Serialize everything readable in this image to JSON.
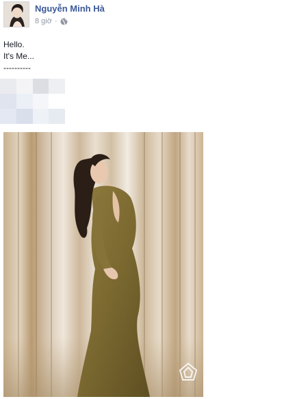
{
  "post": {
    "author_name": "Nguyễn Minh Hà",
    "time": "8 giờ",
    "separator": "·",
    "privacy_icon": "globe-icon",
    "body_lines": [
      "Hello.",
      "It's Me...",
      "----------"
    ],
    "image_alt": "photo-of-woman-in-olive-dress"
  },
  "colors": {
    "link_blue": "#3b5998",
    "meta_gray": "#9197a3",
    "text": "#141823"
  }
}
